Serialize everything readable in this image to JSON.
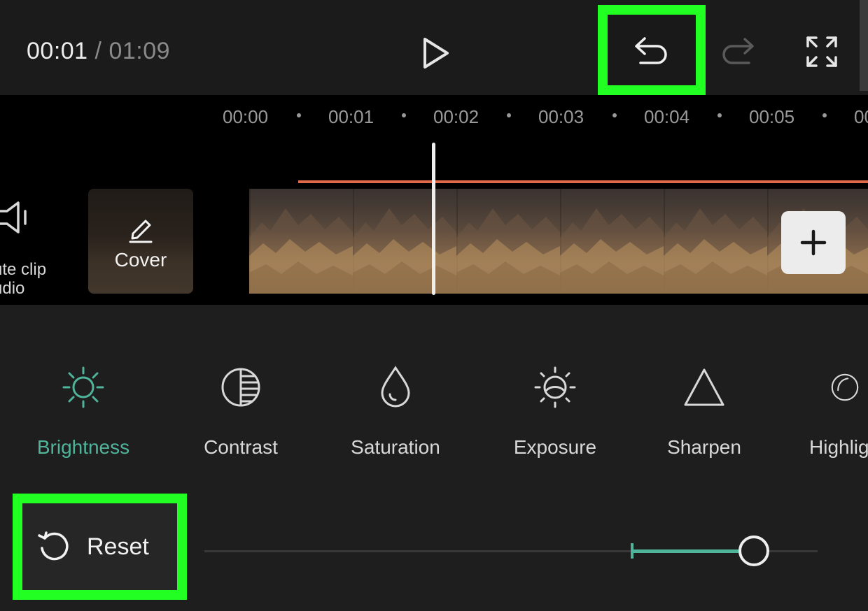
{
  "player": {
    "current_time": "00:01",
    "separator": "/",
    "duration": "01:09",
    "icons": {
      "play": "play-icon",
      "undo": "undo-icon",
      "redo": "redo-icon",
      "fullscreen": "fullscreen-icon"
    }
  },
  "timeline": {
    "ruler": [
      "00:00",
      "00:01",
      "00:02",
      "00:03",
      "00:04",
      "00:05",
      "00"
    ],
    "mute_clip_audio": {
      "label_line1": "ute clip",
      "label_line2": "udio",
      "icon": "speaker-icon"
    },
    "cover": {
      "label": "Cover",
      "icon": "pencil-icon"
    },
    "add_clip_icon": "plus-icon",
    "audio_track_color": "#e06a4a"
  },
  "adjust_tools": {
    "active": "Brightness",
    "accent": "#4fb49a",
    "items": [
      {
        "label": "Brightness",
        "icon": "sun-icon"
      },
      {
        "label": "Contrast",
        "icon": "contrast-icon"
      },
      {
        "label": "Saturation",
        "icon": "drop-icon"
      },
      {
        "label": "Exposure",
        "icon": "exposure-icon"
      },
      {
        "label": "Sharpen",
        "icon": "triangle-icon"
      },
      {
        "label": "Highlig",
        "icon": "highlight-icon"
      }
    ]
  },
  "reset": {
    "label": "Reset",
    "icon": "reset-icon"
  },
  "brightness_slider": {
    "min": -50,
    "max": 50,
    "value": 50
  },
  "highlight_color": "#22ff22"
}
